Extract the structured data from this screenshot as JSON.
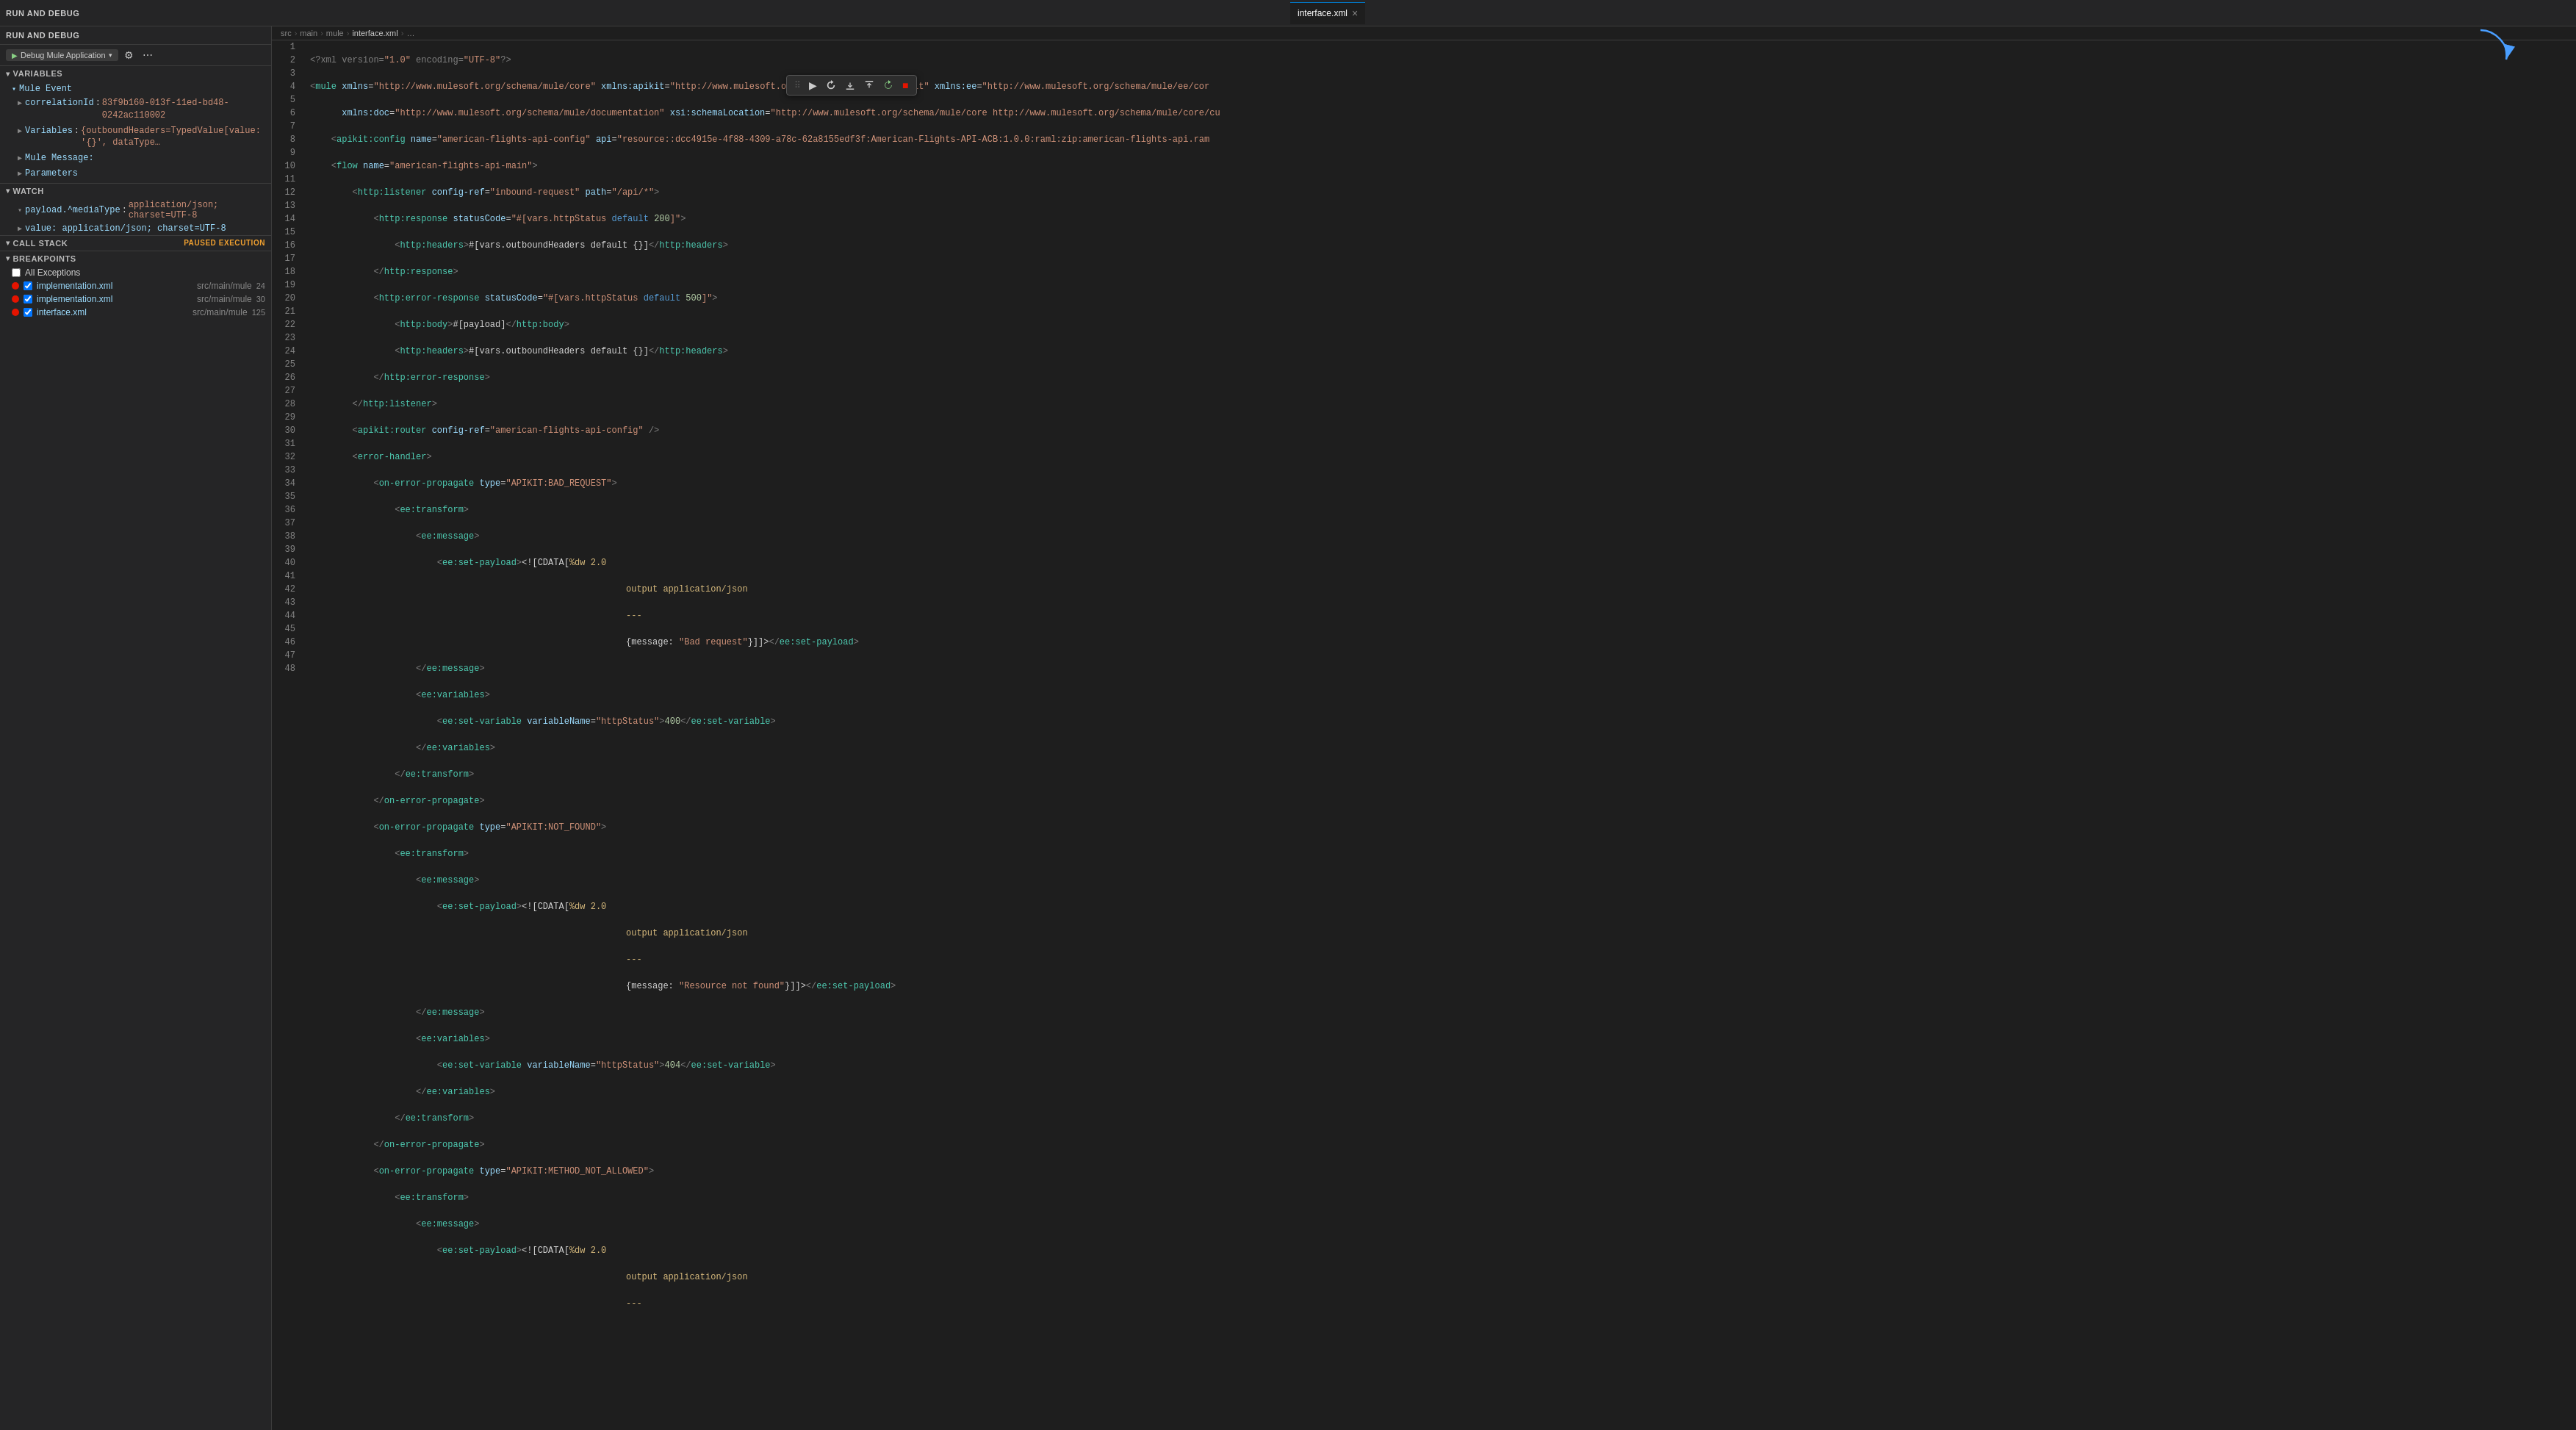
{
  "toolbar": {
    "run_debug_label": "RUN AND DEBUG",
    "debug_config": "Debug Mule Application",
    "settings_icon": "⚙",
    "more_icon": "⋯"
  },
  "tab": {
    "filename": "interface.xml",
    "close_icon": "×"
  },
  "breadcrumb": {
    "parts": [
      "src",
      "main",
      "mule",
      "interface.xml",
      "…"
    ]
  },
  "debug_toolbar": {
    "drag": "⠿",
    "continue": "▶",
    "step_over": "↷",
    "step_into": "↓",
    "step_out": "↑",
    "restart": "↺",
    "stop": "■"
  },
  "sections": {
    "variables": "VARIABLES",
    "watch": "WATCH",
    "call_stack": "CALL STACK",
    "breakpoints": "BREAKPOINTS"
  },
  "variables": {
    "mule_event": "Mule Event",
    "correlation_id_label": "correlationId",
    "correlation_id_val": "83f9b160-013f-11ed-bd48-0242ac110002",
    "variables_label": "Variables",
    "variables_val": "{outboundHeaders=TypedValue[value: '{}', dataType…",
    "mule_message": "Mule Message:",
    "parameters": "Parameters"
  },
  "watch": {
    "item1_name": "payload.^mediaType",
    "item1_val": "application/json; charset=UTF-8",
    "item2_name": "value: application/json; charset=UTF-8"
  },
  "call_stack": {
    "paused_label": "PAUSED EXECUTION"
  },
  "breakpoints": {
    "all_exceptions": "All Exceptions",
    "items": [
      {
        "name": "implementation.xml",
        "path": "src/main/mule",
        "count": "24",
        "checked": true
      },
      {
        "name": "implementation.xml",
        "path": "src/main/mule",
        "count": "30",
        "checked": true
      },
      {
        "name": "interface.xml",
        "path": "src/main/mule",
        "count": "125",
        "checked": true
      }
    ]
  },
  "code_lines": [
    {
      "num": 1,
      "content": "<?xml version=\"1.0\" encoding=\"UTF-8\"?>"
    },
    {
      "num": 2,
      "content": "<mule xmlns=\"http://www.mulesoft.org/schema/mule/core\" xmlns:apikit=\"http://www.mulesoft.org/schema/mule/mule-apikit\" xmlns:ee=\"http://www.mulesoft.org/schema/mule/ee/cor"
    },
    {
      "num": 3,
      "content": "      xmlns:doc=\"http://www.mulesoft.org/schema/mule/documentation\" xsi:schemaLocation=\"http://www.mulesoft.org/schema/mule/core http://www.mulesoft.org/schema/mule/core/cu"
    },
    {
      "num": 4,
      "content": "    <apikit:config name=\"american-flights-api-config\" api=\"resource::dcc4915e-4f88-4309-a78c-62a8155edf3f:American-Flights-API-ACB:1.0.0:raml:zip:american-flights-api.ram"
    },
    {
      "num": 5,
      "content": "    <flow name=\"american-flights-api-main\">"
    },
    {
      "num": 6,
      "content": "        <http:listener config-ref=\"inbound-request\" path=\"/api/*\">"
    },
    {
      "num": 7,
      "content": "            <http:response statusCode=\"#[vars.httpStatus default 200]\">"
    },
    {
      "num": 8,
      "content": "                <http:headers>#[vars.outboundHeaders default {}]</http:headers>"
    },
    {
      "num": 9,
      "content": "            </http:response>"
    },
    {
      "num": 10,
      "content": "            <http:error-response statusCode=\"#[vars.httpStatus default 500]\">"
    },
    {
      "num": 11,
      "content": "                <http:body>#[payload]</http:body>"
    },
    {
      "num": 12,
      "content": "                <http:headers>#[vars.outboundHeaders default {}]</http:headers>"
    },
    {
      "num": 13,
      "content": "            </http:error-response>"
    },
    {
      "num": 14,
      "content": "        </http:listener>"
    },
    {
      "num": 15,
      "content": "        <apikit:router config-ref=\"american-flights-api-config\" />"
    },
    {
      "num": 16,
      "content": "        <error-handler>"
    },
    {
      "num": 17,
      "content": "            <on-error-propagate type=\"APIKIT:BAD_REQUEST\">"
    },
    {
      "num": 18,
      "content": "                <ee:transform>"
    },
    {
      "num": 19,
      "content": "                    <ee:message>"
    },
    {
      "num": 20,
      "content": "                        <ee:set-payload><![CDATA[%dw 2.0"
    },
    {
      "num": 21,
      "content": "output application/json"
    },
    {
      "num": 22,
      "content": "---"
    },
    {
      "num": 23,
      "content": "{message: \"Bad request\"}]]></ee:set-payload>"
    },
    {
      "num": 24,
      "content": "                    </ee:message>"
    },
    {
      "num": 25,
      "content": "                    <ee:variables>"
    },
    {
      "num": 26,
      "content": "                        <ee:set-variable variableName=\"httpStatus\">400</ee:set-variable>"
    },
    {
      "num": 27,
      "content": "                    </ee:variables>"
    },
    {
      "num": 28,
      "content": "                </ee:transform>"
    },
    {
      "num": 29,
      "content": "            </on-error-propagate>"
    },
    {
      "num": 30,
      "content": "            <on-error-propagate type=\"APIKIT:NOT_FOUND\">"
    },
    {
      "num": 31,
      "content": "                <ee:transform>"
    },
    {
      "num": 32,
      "content": "                    <ee:message>"
    },
    {
      "num": 33,
      "content": "                        <ee:set-payload><![CDATA[%dw 2.0"
    },
    {
      "num": 34,
      "content": "output application/json"
    },
    {
      "num": 35,
      "content": "---"
    },
    {
      "num": 36,
      "content": "{message: \"Resource not found\"}]]></ee:set-payload>"
    },
    {
      "num": 37,
      "content": "                    </ee:message>"
    },
    {
      "num": 38,
      "content": "                    <ee:variables>"
    },
    {
      "num": 39,
      "content": "                        <ee:set-variable variableName=\"httpStatus\">404</ee:set-variable>"
    },
    {
      "num": 40,
      "content": "                    </ee:variables>"
    },
    {
      "num": 41,
      "content": "                </ee:transform>"
    },
    {
      "num": 42,
      "content": "            </on-error-propagate>"
    },
    {
      "num": 43,
      "content": "            <on-error-propagate type=\"APIKIT:METHOD_NOT_ALLOWED\">"
    },
    {
      "num": 44,
      "content": "                <ee:transform>"
    },
    {
      "num": 45,
      "content": "                    <ee:message>"
    },
    {
      "num": 46,
      "content": "                        <ee:set-payload><![CDATA[%dw 2.0"
    },
    {
      "num": 47,
      "content": "output application/json"
    },
    {
      "num": 48,
      "content": "---"
    }
  ]
}
